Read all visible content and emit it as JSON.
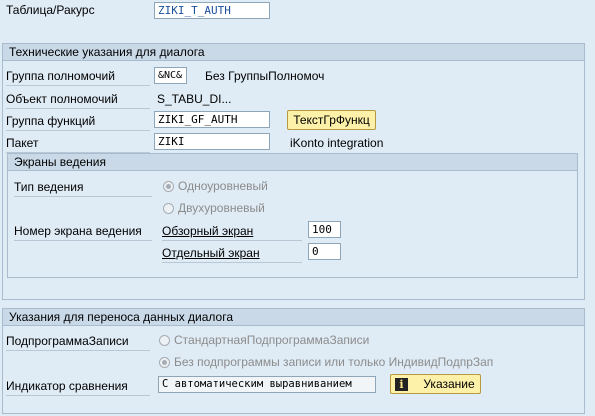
{
  "header": {
    "table_view_label": "Таблица/Ракурс",
    "table_view_value": "ZIKI_T_AUTH"
  },
  "tech": {
    "title": "Технические указания для диалога",
    "auth_group_label": "Группа полномочий",
    "auth_group_value": "&NC&",
    "auth_group_text": "Без ГруппыПолномоч",
    "auth_object_label": "Объект полномочий",
    "auth_object_value": "S_TABU_DI...",
    "func_group_label": "Группа функций",
    "func_group_value": "ZIKI_GF_AUTH",
    "func_group_button": "ТекстГрФункц",
    "package_label": "Пакет",
    "package_value": "ZIKI",
    "package_text": "iKonto integration"
  },
  "screens": {
    "title": "Экраны ведения",
    "type_label": "Тип ведения",
    "one_level": "Одноуровневый",
    "two_level": "Двухуровневый",
    "screen_no_label": "Номер экрана ведения",
    "overview_label": "Обзорный экран",
    "overview_value": "100",
    "single_label": "Отдельный экран",
    "single_value": "0"
  },
  "transfer": {
    "title": "Указания для переноса данных диалога",
    "subprogram_label": "ПодпрограммаЗаписи",
    "option_standard": "СтандартнаяПодпрограммаЗаписи",
    "option_none": "Без подпрограммы записи или только ИндивидПодпрЗап",
    "compare_label": "Индикатор сравнения",
    "compare_value": "С автоматическим выравниванием",
    "hint_button": "Указание"
  },
  "icons": {
    "hint_icon": "info-icon"
  }
}
